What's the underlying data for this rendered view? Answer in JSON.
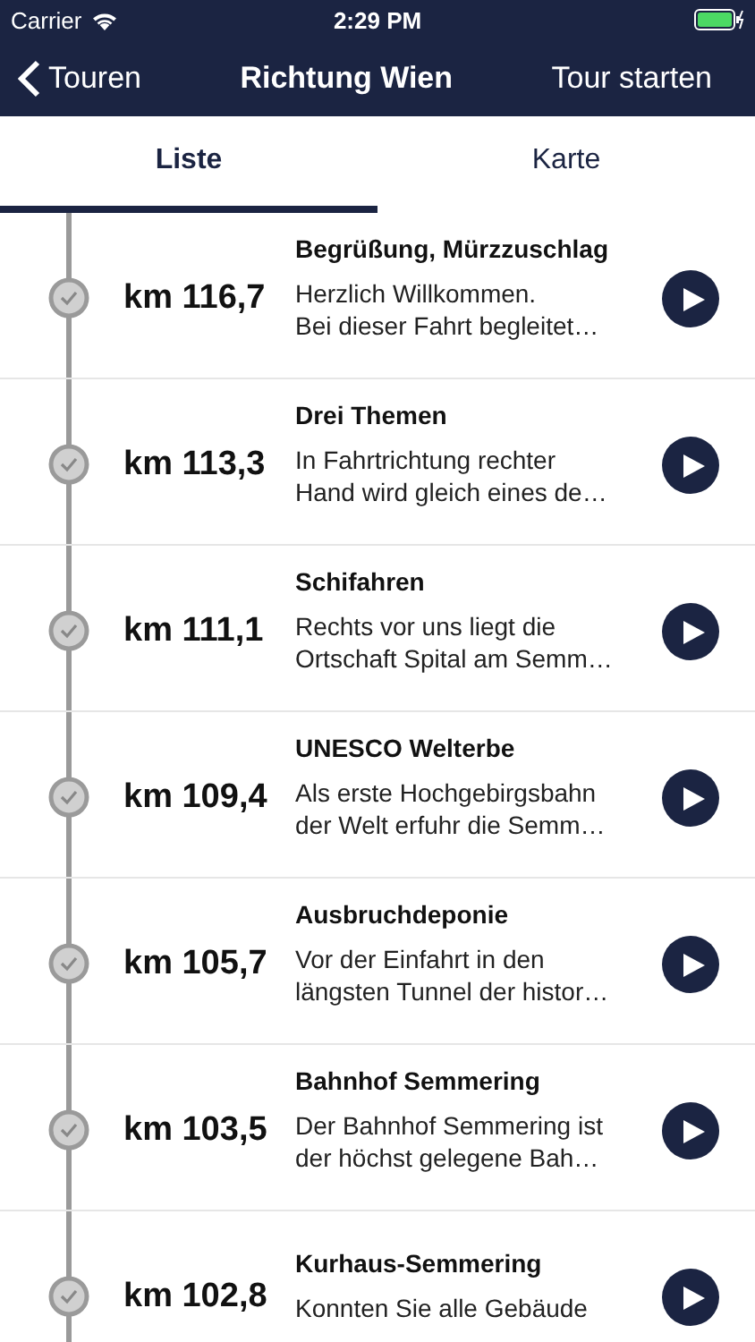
{
  "status_bar": {
    "carrier": "Carrier",
    "time": "2:29 PM"
  },
  "nav": {
    "back": "Touren",
    "title": "Richtung Wien",
    "action": "Tour starten"
  },
  "tabs": [
    {
      "label": "Liste",
      "selected": true
    },
    {
      "label": "Karte",
      "selected": false
    }
  ],
  "stops": [
    {
      "km": "km 116,7",
      "title": "Begrüßung, Mürzzuschlag",
      "text": "Herzlich Willkommen.\nBei dieser Fahrt begleitet…",
      "done": true
    },
    {
      "km": "km 113,3",
      "title": "Drei Themen",
      "text": "In Fahrtrichtung rechter\nHand wird gleich eines de…",
      "done": true
    },
    {
      "km": "km 111,1",
      "title": "Schifahren",
      "text": "Rechts vor uns liegt die\nOrtschaft Spital am Semm…",
      "done": true
    },
    {
      "km": "km 109,4",
      "title": "UNESCO Welterbe",
      "text": "Als erste Hochgebirgsbahn\nder Welt erfuhr die Semm…",
      "done": true
    },
    {
      "km": "km 105,7",
      "title": "Ausbruchdeponie",
      "text": "Vor der Einfahrt in den\nlängsten Tunnel der histor…",
      "done": true
    },
    {
      "km": "km 103,5",
      "title": "Bahnhof Semmering",
      "text": "Der Bahnhof Semmering ist\nder höchst gelegene Bah…",
      "done": true
    },
    {
      "km": "km 102,8",
      "title": "Kurhaus-Semmering",
      "text": "Konnten Sie alle Gebäude",
      "done": true
    }
  ]
}
